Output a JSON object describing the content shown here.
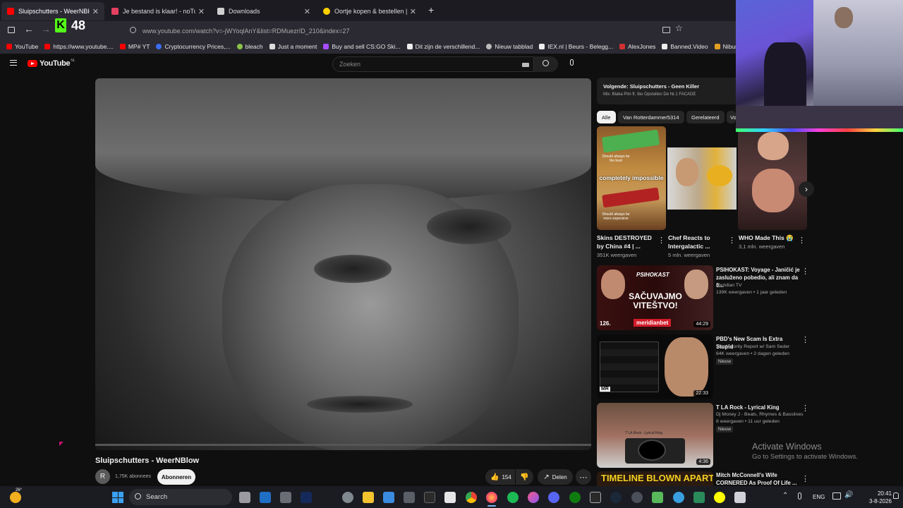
{
  "browser": {
    "tabs": [
      {
        "title": "Sluipschutters - WeerNBlow",
        "active": true,
        "favicon_color": "#ff0000"
      },
      {
        "title": "Je bestand is klaar! - noTube",
        "active": false,
        "favicon_color": "#e4405f"
      },
      {
        "title": "Downloads",
        "active": false,
        "favicon_color": "#cfcfcf"
      },
      {
        "title": "Oortje kopen & bestellen | Jumbo",
        "active": false,
        "favicon_color": "#ffd000"
      }
    ],
    "new_tab_symbol": "+",
    "address": "www.youtube.com/watch?v=-jWYoqlAnY&list=RDMuezrID_210&index=27",
    "overlay_counter": "48",
    "bookmarks": [
      {
        "label": "YouTube",
        "color": "#ff0000"
      },
      {
        "label": "https://www.youtube....",
        "color": "#ff0000"
      },
      {
        "label": "MP# YT",
        "color": "#ff0000"
      },
      {
        "label": "Cryptocurrency Prices,...",
        "color": "#3c6df0"
      },
      {
        "label": "bleach",
        "color": "#8bc34a"
      },
      {
        "label": "Just a moment",
        "color": "#dddddd"
      },
      {
        "label": "Buy and sell CS:GO Ski...",
        "color": "#a64dff"
      },
      {
        "label": "Dit zijn de verschillend...",
        "color": "#eeeeee"
      },
      {
        "label": "Nieuw tabblad",
        "color": "#bbbbbb"
      },
      {
        "label": "IEX.nl | Beurs - Belegg...",
        "color": "#eeeeee"
      },
      {
        "label": "AlexJones",
        "color": "#d03030"
      },
      {
        "label": "Banned.Video",
        "color": "#eeeeee"
      },
      {
        "label": "Niburu.co :: Onthulle",
        "color": "#e0a020"
      }
    ]
  },
  "youtube": {
    "logo_text": "YouTube",
    "logo_region": "NL",
    "search_placeholder": "Zoeken",
    "video": {
      "title": "Sluipschutters - WeerNBlow",
      "channel_initial": "R",
      "subscribers": "1,75K abonnees",
      "subscribe_label": "Abonneren",
      "likes": "154",
      "share_label": "Delen"
    },
    "up_next": {
      "label": "Volgende: Sluipschutters - Geen Killer",
      "mix": "Mix: Blaka Pim ft. Ibo Opstelten De Nr.1 FACADE"
    },
    "chips": [
      "Alle",
      "Van Rotterdammer5314",
      "Gerelateerd",
      "Vo"
    ],
    "shorts": [
      {
        "title": "Skins DESTROYED by China #4 | ...",
        "views": "351K weergaven",
        "overlay": "completely impossible",
        "caption_top": "Should always be the best",
        "caption_bottom": "Should always be more expensive"
      },
      {
        "title": "Chef Reacts to Intergalactic ...",
        "views": "5 mln. weergaven"
      },
      {
        "title": "WHO Made This 😭",
        "views": "3,1 mln. weergaven"
      }
    ],
    "videos": [
      {
        "title": "PSIHOKAST: Voyage - Janičić je zasluženo pobedio, ali znam da č...",
        "channel": "Meridian TV",
        "meta": "139K weergaven • 1 jaar geleden",
        "duration": "44:29",
        "badge": "",
        "thumb_text": "SAČUVAJMO VITEŠTVO!",
        "thumb_brand": "meridianbet",
        "thumb_logo": "PSIHOKAST",
        "thumb_episode": "126."
      },
      {
        "title": "PBD's New Scam Is Extra Stupid",
        "channel": "The Majority Report w/ Sam Seder",
        "meta": "64K weergaven • 2 dagen geleden",
        "duration": "22:33",
        "badge": "Nieuw",
        "thumb_logo": "MR"
      },
      {
        "title": "T LA Rock - Lyrical King",
        "channel": "Dj Money J - Beats, Rhymes & Basslines",
        "meta": "8 weergaven • 11 uur geleden",
        "duration": "4:36",
        "badge": "Nieuw",
        "thumb_caption": "T LA Rock - Lyrical King"
      },
      {
        "title": "Mitch McConnell's Wife CORNERED As Proof Of Life ...",
        "channel": "",
        "meta": "",
        "duration": "",
        "badge": "",
        "thumb_text": "TIMELINE BLOWN APART"
      }
    ]
  },
  "windows": {
    "activate_title": "Activate Windows",
    "activate_sub": "Go to Settings to activate Windows.",
    "search_label": "Search",
    "weather_temp": "26°",
    "language": "ENG",
    "time": "20:41",
    "date": "3-8-2026"
  }
}
